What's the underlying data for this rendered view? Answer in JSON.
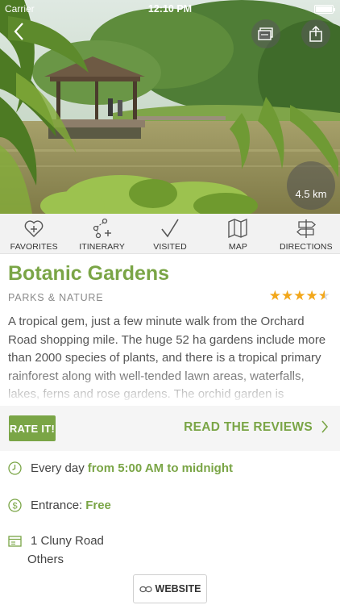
{
  "status_bar": {
    "carrier": "Carrier",
    "time": "12:10 PM"
  },
  "hero": {
    "distance": "4.5 km"
  },
  "actions": [
    {
      "label": "FAVORITES",
      "icon": "heart-plus-icon"
    },
    {
      "label": "ITINERARY",
      "icon": "route-icon"
    },
    {
      "label": "VISITED",
      "icon": "checkmark-icon"
    },
    {
      "label": "MAP",
      "icon": "map-icon"
    },
    {
      "label": "DIRECTIONS",
      "icon": "signpost-icon"
    }
  ],
  "place": {
    "title": "Botanic Gardens",
    "category": "PARKS & NATURE",
    "rating": 4.5,
    "description": "A tropical gem, just a few minute walk from the Orchard Road shopping mile. The huge 52 ha gardens include more than 2000 species of plants, and there is a tropical primary rainforest along with well-tended lawn areas, waterfalls, lakes, ferns and rose gardens. The orchid garden is"
  },
  "rate_bar": {
    "rate_label": "RATE IT!",
    "reviews_label": "READ THE REVIEWS"
  },
  "details": {
    "hours_prefix": "Every day",
    "hours_value": "from 5:00 AM to midnight",
    "entrance_label": "Entrance:",
    "entrance_value": "Free",
    "address_line1": "1 Cluny Road",
    "address_line2": "Others"
  },
  "website_label": "WEBSITE",
  "colors": {
    "accent": "#7aa546",
    "star": "#f2a71b"
  }
}
